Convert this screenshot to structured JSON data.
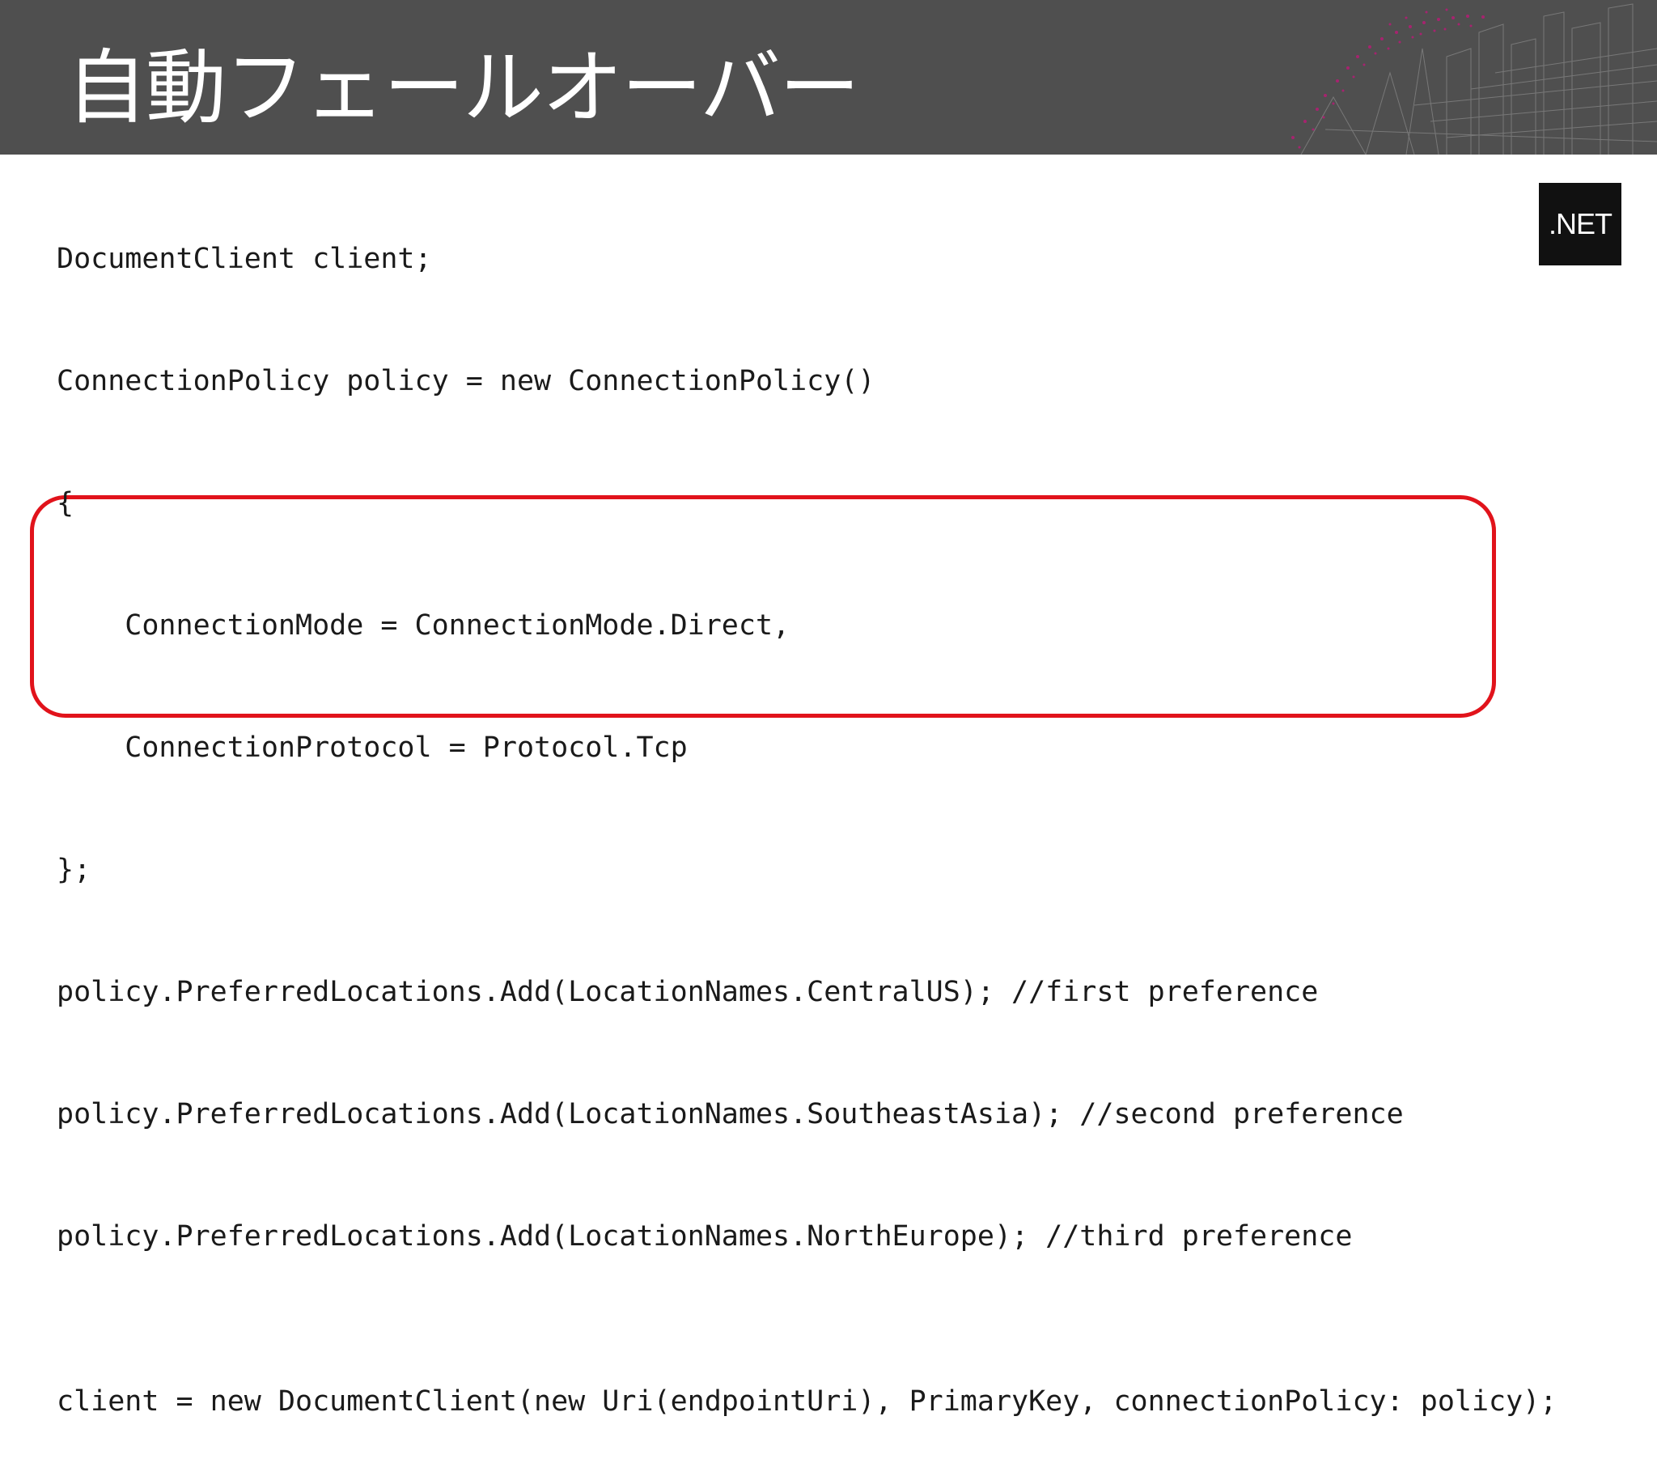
{
  "slide": {
    "title": "自動フェールオーバー",
    "badge": ".NET",
    "highlight_color": "#e1131b",
    "header_color": "#4f4f4f"
  },
  "code": {
    "lines": [
      "DocumentClient client;",
      "ConnectionPolicy policy = new ConnectionPolicy()",
      "{",
      "    ConnectionMode = ConnectionMode.Direct,",
      "    ConnectionProtocol = Protocol.Tcp",
      "};",
      "policy.PreferredLocations.Add(LocationNames.CentralUS); //first preference",
      "policy.PreferredLocations.Add(LocationNames.SoutheastAsia); //second preference",
      "policy.PreferredLocations.Add(LocationNames.NorthEurope); //third preference",
      "client = new DocumentClient(new Uri(endpointUri), PrimaryKey, connectionPolicy: policy);"
    ]
  }
}
